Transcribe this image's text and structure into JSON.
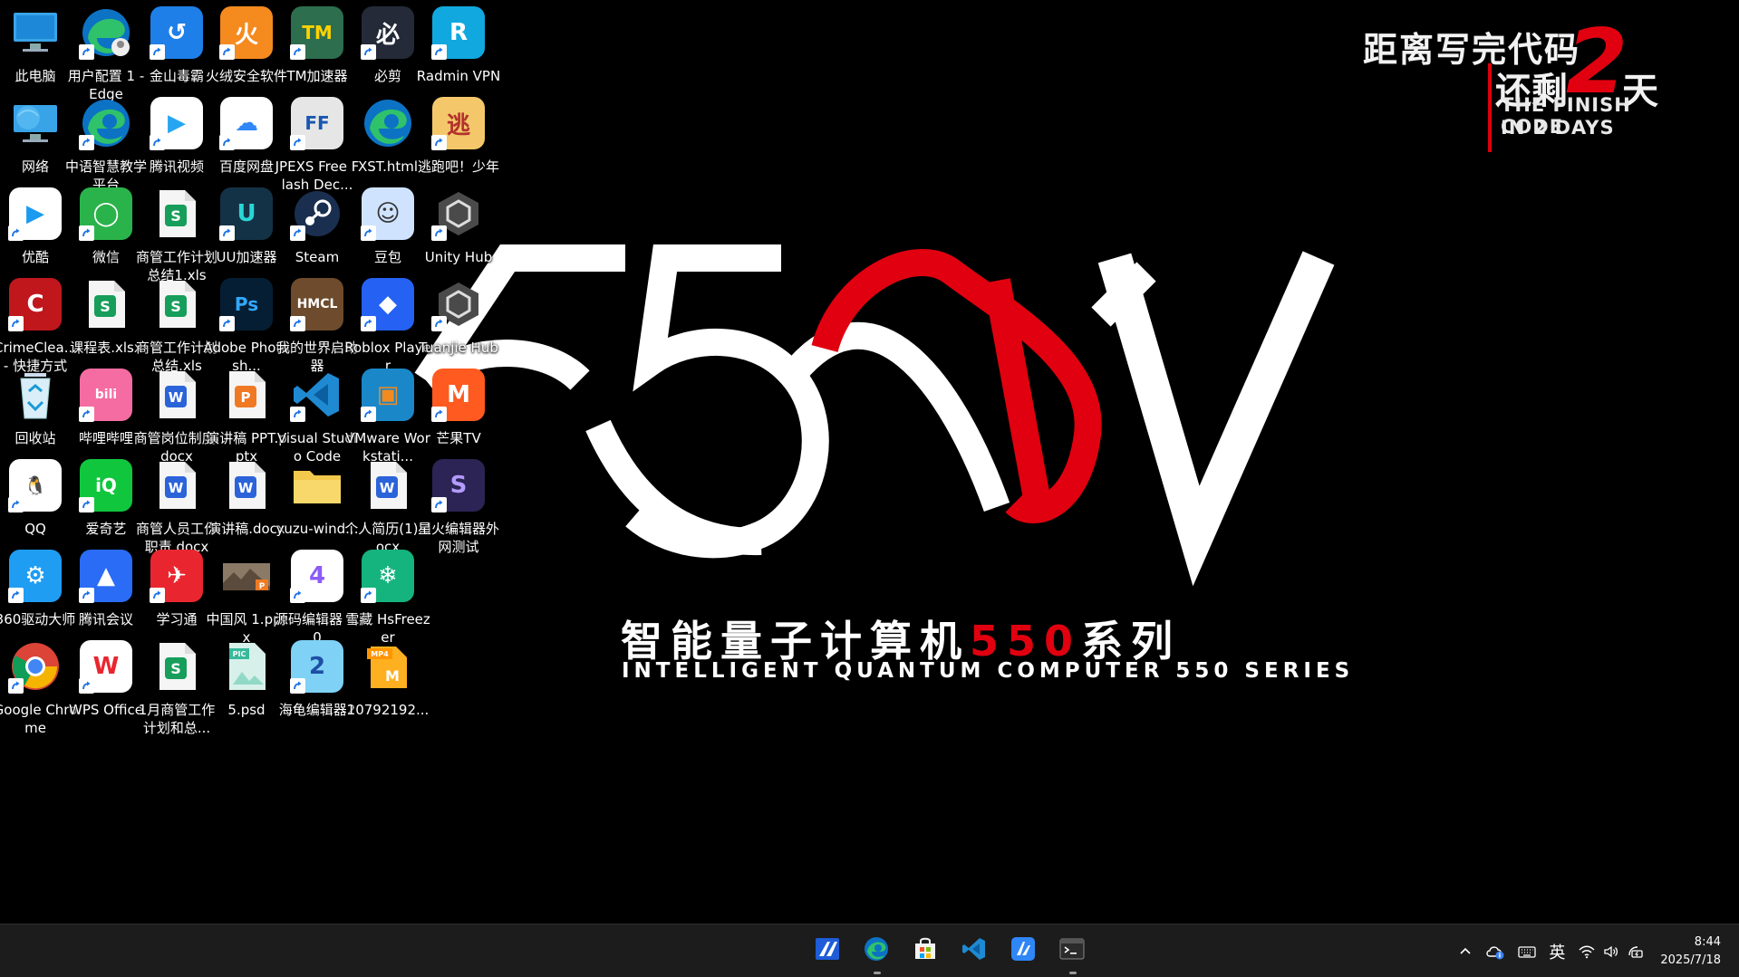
{
  "wallpaper": {
    "countdown_line1": "距离写完代码",
    "countdown_line2": "还剩",
    "countdown_number": "2",
    "countdown_unit": "天",
    "countdown_en1": "THE FINISH CODE",
    "countdown_en2": "IN 2 DAYS",
    "series_cn_prefix": "智能量子计算机",
    "series_cn_number": "550",
    "series_cn_suffix": "系列",
    "series_en": "INTELLIGENT QUANTUM COMPUTER 550 SERIES",
    "accent_color": "#e1000f"
  },
  "desktop": {
    "icons": [
      {
        "label": "此电脑",
        "icon": "computer-icon",
        "shortcut": false
      },
      {
        "label": "用户配置 1 - Edge",
        "icon": "edge-profile-icon",
        "shortcut": true
      },
      {
        "label": "金山毒霸",
        "icon": "kingsoft-antivirus-icon",
        "shortcut": true
      },
      {
        "label": "火绒安全软件",
        "icon": "huorong-icon",
        "shortcut": true
      },
      {
        "label": "TM加速器",
        "icon": "tm-accelerator-icon",
        "shortcut": true
      },
      {
        "label": "必剪",
        "icon": "bijian-icon",
        "shortcut": true
      },
      {
        "label": "Radmin VPN",
        "icon": "radmin-vpn-icon",
        "shortcut": true
      },
      {
        "label": "网络",
        "icon": "network-icon",
        "shortcut": false
      },
      {
        "label": "中语智慧教学平台",
        "icon": "edge-icon",
        "shortcut": true
      },
      {
        "label": "腾讯视频",
        "icon": "tencent-video-icon",
        "shortcut": true
      },
      {
        "label": "百度网盘",
        "icon": "baidu-netdisk-icon",
        "shortcut": true
      },
      {
        "label": "JPEXS Free Flash Dec...",
        "icon": "jpexs-icon",
        "shortcut": true
      },
      {
        "label": "XST.html",
        "icon": "edge-html-icon",
        "shortcut": false
      },
      {
        "label": "逃跑吧！少年",
        "icon": "game-icon",
        "shortcut": true
      },
      {
        "label": "优酷",
        "icon": "youku-icon",
        "shortcut": true
      },
      {
        "label": "微信",
        "icon": "wechat-icon",
        "shortcut": true
      },
      {
        "label": "商管工作计划总结1.xls",
        "icon": "spreadsheet-icon",
        "shortcut": false
      },
      {
        "label": "UU加速器",
        "icon": "uu-accelerator-icon",
        "shortcut": true
      },
      {
        "label": "Steam",
        "icon": "steam-icon",
        "shortcut": true
      },
      {
        "label": "豆包",
        "icon": "doubao-icon",
        "shortcut": true
      },
      {
        "label": "Unity Hub",
        "icon": "unity-icon",
        "shortcut": true
      },
      {
        "label": "CrimeClea... - 快捷方式",
        "icon": "crimecleaners-icon",
        "shortcut": true
      },
      {
        "label": "课程表.xlsx",
        "icon": "spreadsheet-icon",
        "shortcut": false
      },
      {
        "label": "商管工作计划总结.xls",
        "icon": "spreadsheet-icon",
        "shortcut": false
      },
      {
        "label": "Adobe Photosh...",
        "icon": "photoshop-icon",
        "shortcut": true
      },
      {
        "label": "我的世界启动器",
        "icon": "hmcl-icon",
        "shortcut": true
      },
      {
        "label": "Roblox Player",
        "icon": "roblox-icon",
        "shortcut": true
      },
      {
        "label": "Tuanjie Hub",
        "icon": "unity-icon",
        "shortcut": true
      },
      {
        "label": "回收站",
        "icon": "recycle-bin-icon",
        "shortcut": false
      },
      {
        "label": "哔哩哔哩",
        "icon": "bilibili-icon",
        "shortcut": true
      },
      {
        "label": "商管岗位制度.docx",
        "icon": "word-doc-icon",
        "shortcut": false
      },
      {
        "label": "演讲稿 PPT.pptx",
        "icon": "powerpoint-icon",
        "shortcut": false
      },
      {
        "label": "Visual Studio Code",
        "icon": "vscode-icon",
        "shortcut": true
      },
      {
        "label": "VMware Workstati...",
        "icon": "vmware-icon",
        "shortcut": true
      },
      {
        "label": "芒果TV",
        "icon": "mango-tv-icon",
        "shortcut": true
      },
      {
        "label": "QQ",
        "icon": "qq-icon",
        "shortcut": true
      },
      {
        "label": "爱奇艺",
        "icon": "iqiyi-icon",
        "shortcut": true
      },
      {
        "label": "商管人员工作职责.docx",
        "icon": "word-doc-icon",
        "shortcut": false
      },
      {
        "label": "演讲稿.docx",
        "icon": "word-doc-icon",
        "shortcut": false
      },
      {
        "label": "yuzu-wind...",
        "icon": "folder-icon",
        "shortcut": false
      },
      {
        "label": "个人简历(1).docx",
        "icon": "word-doc-icon",
        "shortcut": false
      },
      {
        "label": "星火编辑器外网测试",
        "icon": "spark-editor-icon",
        "shortcut": true
      },
      {
        "label": "360驱动大师",
        "icon": "driver-master-icon",
        "shortcut": true
      },
      {
        "label": "腾讯会议",
        "icon": "tencent-meeting-icon",
        "shortcut": true
      },
      {
        "label": "学习通",
        "icon": "xuexitong-icon",
        "shortcut": true
      },
      {
        "label": "中国风 1.pptx",
        "icon": "pptx-image-icon",
        "shortcut": false
      },
      {
        "label": "源码编辑器 4.0",
        "icon": "code-editor-icon",
        "shortcut": true
      },
      {
        "label": "雪藏 HsFreezer",
        "icon": "hsfreezer-icon",
        "shortcut": true
      },
      {
        "label": "Google Chrome",
        "icon": "chrome-icon",
        "shortcut": true
      },
      {
        "label": "WPS Office",
        "icon": "wps-icon",
        "shortcut": true
      },
      {
        "label": "1月商管工作计划和总...",
        "icon": "spreadsheet-icon",
        "shortcut": false
      },
      {
        "label": "5.psd",
        "icon": "psd-file-icon",
        "shortcut": false
      },
      {
        "label": "海龟编辑器2",
        "icon": "turtle-editor-icon",
        "shortcut": true
      },
      {
        "label": "10792192...",
        "icon": "mp4-file-icon",
        "shortcut": false
      }
    ]
  },
  "taskbar": {
    "apps": [
      {
        "name": "taskbar-app-1",
        "icon": "app-a-icon",
        "running": false
      },
      {
        "name": "taskbar-edge",
        "icon": "edge-icon",
        "running": true
      },
      {
        "name": "taskbar-store",
        "icon": "store-icon",
        "running": false
      },
      {
        "name": "taskbar-vscode",
        "icon": "vscode-icon",
        "running": false
      },
      {
        "name": "taskbar-app-5",
        "icon": "app-b-icon",
        "running": false
      },
      {
        "name": "taskbar-terminal",
        "icon": "terminal-icon",
        "running": true
      }
    ],
    "tray": {
      "ime_label": "英",
      "time": "8:44",
      "date": "2025/7/18"
    }
  }
}
